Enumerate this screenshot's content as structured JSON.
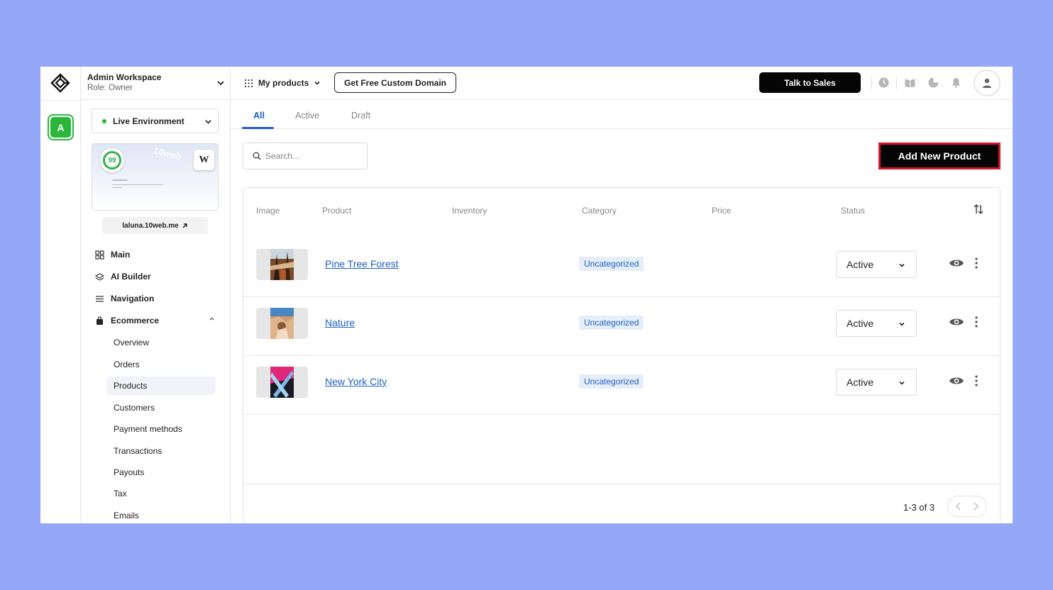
{
  "workspace": {
    "name": "Admin Workspace",
    "role": "Role: Owner",
    "badge": "A"
  },
  "environment": {
    "label": "Live Environment",
    "status_color": "#2bb53a"
  },
  "site": {
    "score": "99",
    "wp_badge": "W",
    "watermark": "10web",
    "domain": "laluna.10web.me"
  },
  "sidebar": {
    "items": [
      {
        "label": "Main",
        "icon": "grid-icon"
      },
      {
        "label": "AI Builder",
        "icon": "layers-icon"
      },
      {
        "label": "Navigation",
        "icon": "menu-icon"
      },
      {
        "label": "Ecommerce",
        "icon": "shopping-bag-icon"
      }
    ],
    "ecommerce_sub": [
      "Overview",
      "Orders",
      "Products",
      "Customers",
      "Payment methods",
      "Transactions",
      "Payouts",
      "Tax",
      "Emails"
    ],
    "active_sub": "Products"
  },
  "topbar": {
    "products_menu": "My products",
    "free_domain": "Get Free Custom Domain",
    "talk_to_sales": "Talk to Sales",
    "icons": [
      "clock-icon",
      "book-icon",
      "pie-chart-icon",
      "bell-icon",
      "user-avatar-icon"
    ]
  },
  "tabs": [
    "All",
    "Active",
    "Draft"
  ],
  "active_tab": "All",
  "search": {
    "placeholder": "Search..."
  },
  "add_button": "Add New Product",
  "table": {
    "columns": [
      "Image",
      "Product",
      "Inventory",
      "Category",
      "Price",
      "Status"
    ],
    "rows": [
      {
        "product": "Pine Tree Forest",
        "inventory": "",
        "category": "Uncategorized",
        "price": "",
        "status": "Active"
      },
      {
        "product": "Nature",
        "inventory": "",
        "category": "Uncategorized",
        "price": "",
        "status": "Active"
      },
      {
        "product": "New York City",
        "inventory": "",
        "category": "Uncategorized",
        "price": "",
        "status": "Active"
      }
    ]
  },
  "pagination": {
    "text": "1-3 of 3"
  },
  "colors": {
    "accent": "#1f5fc6",
    "highlight": "#d8182d",
    "background": "#95a7f7",
    "primary_button": "#050505"
  }
}
